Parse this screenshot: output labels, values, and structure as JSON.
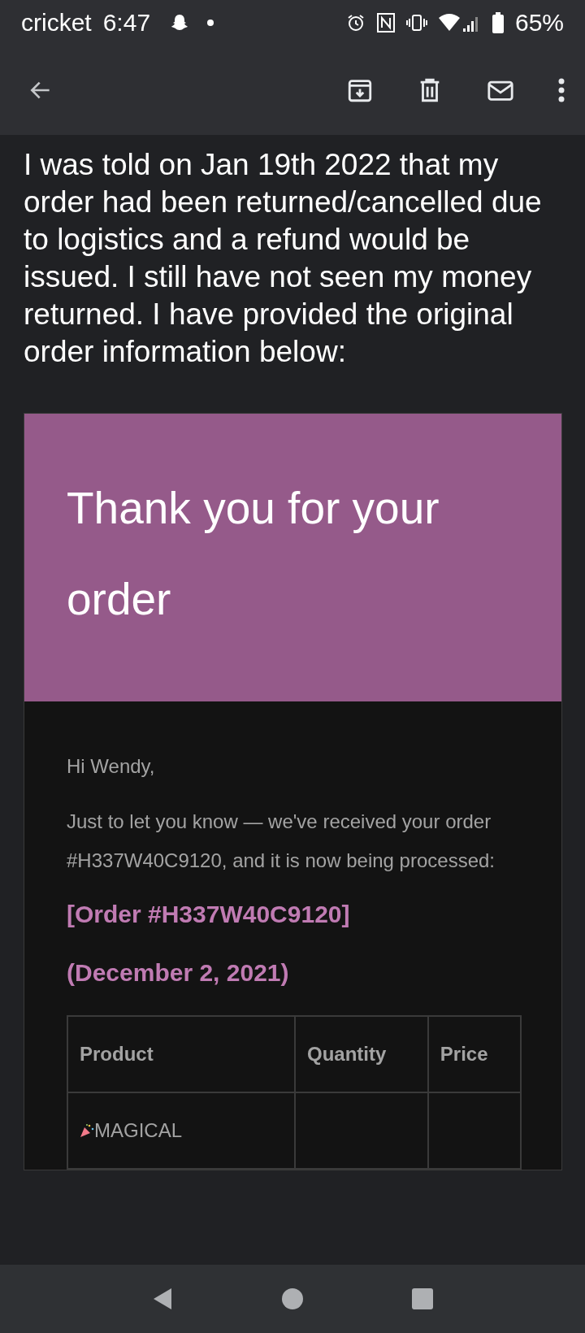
{
  "status_bar": {
    "carrier": "cricket",
    "time": "6:47",
    "battery": "65%"
  },
  "message": {
    "text": "I was told on Jan 19th 2022 that my order had been returned/cancelled due to logistics and a refund  would be issued. I still have not seen my money returned. I have provided the original order information below:"
  },
  "email": {
    "title": "Thank you for your order",
    "greeting": "Hi Wendy,",
    "paragraph": "Just to let you know — we've received your order #H337W40C9120, and it is now being processed:",
    "order_link": "[Order #H337W40C9120]",
    "order_date": "(December 2, 2021)",
    "table": {
      "columns": [
        "Product",
        "Quantity",
        "Price"
      ],
      "rows": [
        [
          "MAGICAL",
          "",
          ""
        ]
      ]
    }
  }
}
